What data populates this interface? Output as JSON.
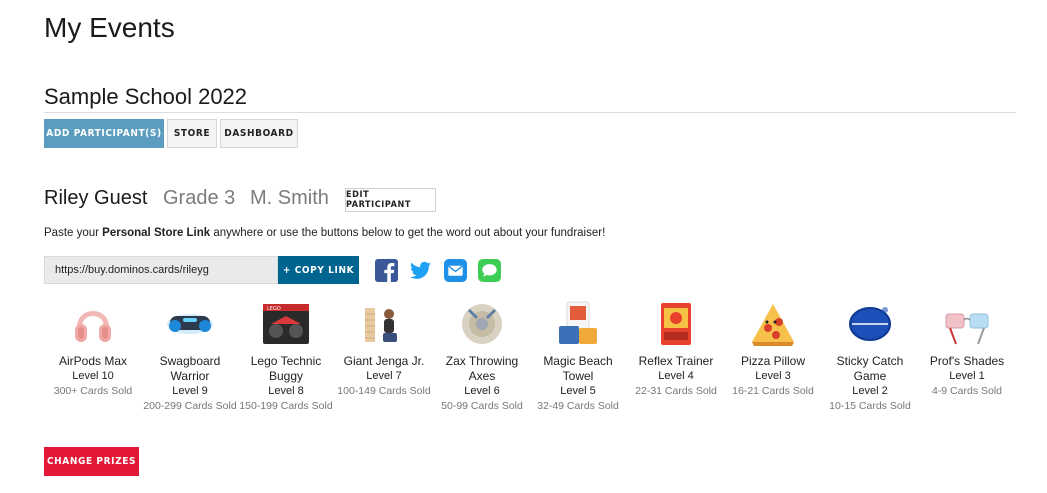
{
  "page": {
    "title": "My Events"
  },
  "event": {
    "title": "Sample School 2022",
    "buttons": {
      "add": "ADD PARTICIPANT(S)",
      "store": "STORE",
      "dashboard": "DASHBOARD"
    }
  },
  "participant": {
    "name": "Riley Guest",
    "grade": "Grade 3",
    "teacher": "M. Smith",
    "edit_label": "EDIT PARTICIPANT"
  },
  "instructions": {
    "prefix": "Paste your ",
    "bold": "Personal Store Link",
    "suffix": " anywhere or use the buttons below to get the word out about your fundraiser!"
  },
  "store_link": {
    "url": "https://buy.dominos.cards/rileyg",
    "copy_label": "+ COPY LINK"
  },
  "share_icons": [
    "facebook-icon",
    "twitter-icon",
    "email-icon",
    "message-icon"
  ],
  "prizes": [
    {
      "name": "AirPods Max",
      "level": "Level 10",
      "cards": "300+ Cards Sold",
      "icon": "headphones-image"
    },
    {
      "name": "Swagboard Warrior",
      "level": "Level 9",
      "cards": "200-299 Cards Sold",
      "icon": "hoverboard-image"
    },
    {
      "name": "Lego Technic Buggy",
      "level": "Level 8",
      "cards": "150-199 Cards Sold",
      "icon": "lego-buggy-image"
    },
    {
      "name": "Giant Jenga Jr.",
      "level": "Level 7",
      "cards": "100-149 Cards Sold",
      "icon": "jenga-image"
    },
    {
      "name": "Zax Throwing Axes",
      "level": "Level 6",
      "cards": "50-99 Cards Sold",
      "icon": "axes-image"
    },
    {
      "name": "Magic Beach Towel",
      "level": "Level 5",
      "cards": "32-49 Cards Sold",
      "icon": "towel-image"
    },
    {
      "name": "Reflex Trainer",
      "level": "Level 4",
      "cards": "22-31 Cards Sold",
      "icon": "reflex-trainer-image"
    },
    {
      "name": "Pizza Pillow",
      "level": "Level 3",
      "cards": "16-21 Cards Sold",
      "icon": "pizza-pillow-image"
    },
    {
      "name": "Sticky Catch Game",
      "level": "Level 2",
      "cards": "10-15 Cards Sold",
      "icon": "catch-game-image"
    },
    {
      "name": "Prof's Shades",
      "level": "Level 1",
      "cards": "4-9 Cards Sold",
      "icon": "shades-image"
    }
  ],
  "change_prizes_label": "CHANGE PRIZES",
  "colors": {
    "primary_blue": "#5a9dbf",
    "dominos_blue": "#006491",
    "dominos_red": "#e31837"
  }
}
